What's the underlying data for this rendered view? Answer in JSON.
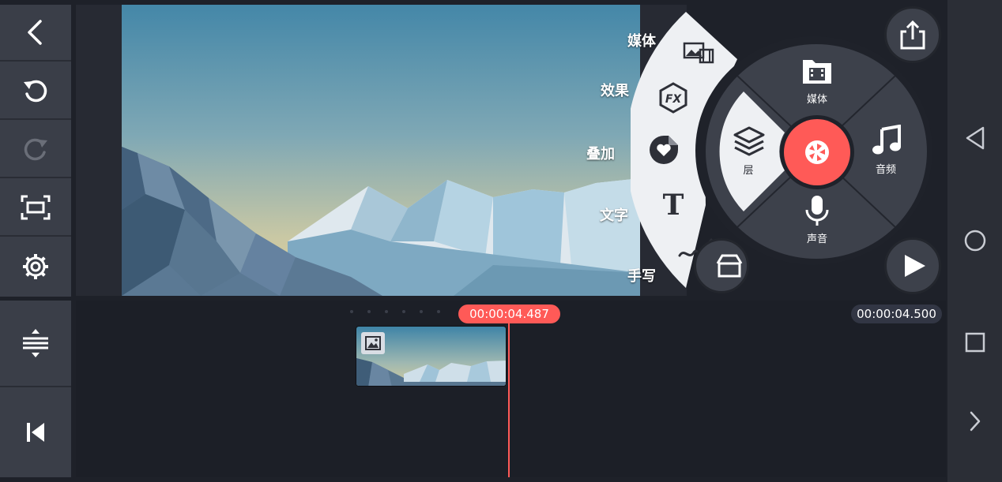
{
  "left_toolbar": {
    "items": [
      {
        "name": "back-icon"
      },
      {
        "name": "undo-icon"
      },
      {
        "name": "redo-icon"
      },
      {
        "name": "fullscreen-icon"
      },
      {
        "name": "settings-icon"
      }
    ]
  },
  "left_bottom": {
    "items": [
      {
        "name": "timeline-expand-icon"
      },
      {
        "name": "skip-to-start-icon"
      }
    ]
  },
  "layer_menu": {
    "items": [
      {
        "label": "媒体",
        "icon": "image-layer-icon"
      },
      {
        "label": "效果",
        "icon": "fx-icon"
      },
      {
        "label": "叠加",
        "icon": "sticker-icon"
      },
      {
        "label": "文字",
        "icon": "text-icon"
      },
      {
        "label": "手写",
        "icon": "handwriting-icon"
      }
    ]
  },
  "wheel": {
    "media": "媒体",
    "audio": "音频",
    "voice": "声音",
    "layer": "层",
    "record": "record-icon"
  },
  "timeline": {
    "playhead_time": "00:00:04.487",
    "total_time": "00:00:04.500"
  },
  "colors": {
    "accent": "#ff5a57",
    "panel": "#3a3e48",
    "background": "#1e2129"
  }
}
